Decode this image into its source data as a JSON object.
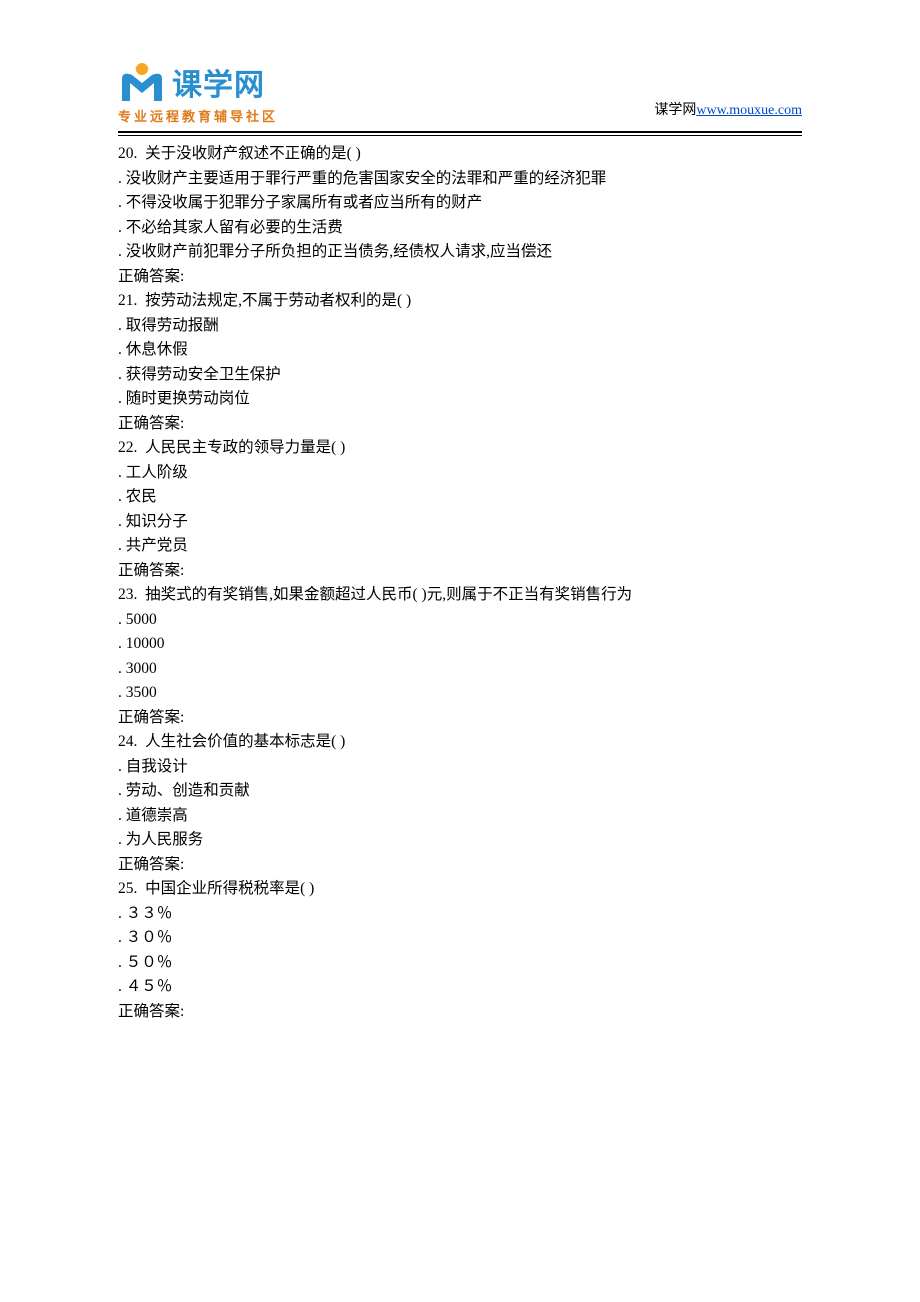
{
  "header": {
    "logo_text": "课学网",
    "logo_sub": "专业远程教育辅导社区",
    "site_label": "谋学网",
    "site_url": "www.mouxue.com"
  },
  "questions": [
    {
      "num": "20.",
      "stem": "关于没收财产叙述不正确的是(   )",
      "options": [
        "没收财产主要适用于罪行严重的危害国家安全的法罪和严重的经济犯罪",
        "不得没收属于犯罪分子家属所有或者应当所有的财产",
        "不必给其家人留有必要的生活费",
        "没收财产前犯罪分子所负担的正当债务,经债权人请求,应当偿还"
      ],
      "answer_label": "正确答案:"
    },
    {
      "num": "21.",
      "stem": "按劳动法规定,不属于劳动者权利的是( )",
      "options": [
        "取得劳动报酬",
        "休息休假",
        "获得劳动安全卫生保护",
        "随时更换劳动岗位"
      ],
      "answer_label": "正确答案:"
    },
    {
      "num": "22.",
      "stem": "人民民主专政的领导力量是( )",
      "options": [
        "工人阶级",
        "农民",
        "知识分子",
        "共产党员"
      ],
      "answer_label": "正确答案:"
    },
    {
      "num": "23.",
      "stem": "抽奖式的有奖销售,如果金额超过人民币( )元,则属于不正当有奖销售行为",
      "options": [
        "5000",
        "10000",
        "3000",
        "3500"
      ],
      "answer_label": "正确答案:"
    },
    {
      "num": "24.",
      "stem": "人生社会价值的基本标志是(   )",
      "options": [
        "自我设计",
        "劳动、创造和贡献",
        "道德崇高",
        "为人民服务"
      ],
      "answer_label": "正确答案:"
    },
    {
      "num": "25.",
      "stem": "中国企业所得税税率是(     )",
      "options": [
        "３３％",
        "３０％",
        "５０％",
        "４５％"
      ],
      "answer_label": "正确答案:"
    }
  ]
}
